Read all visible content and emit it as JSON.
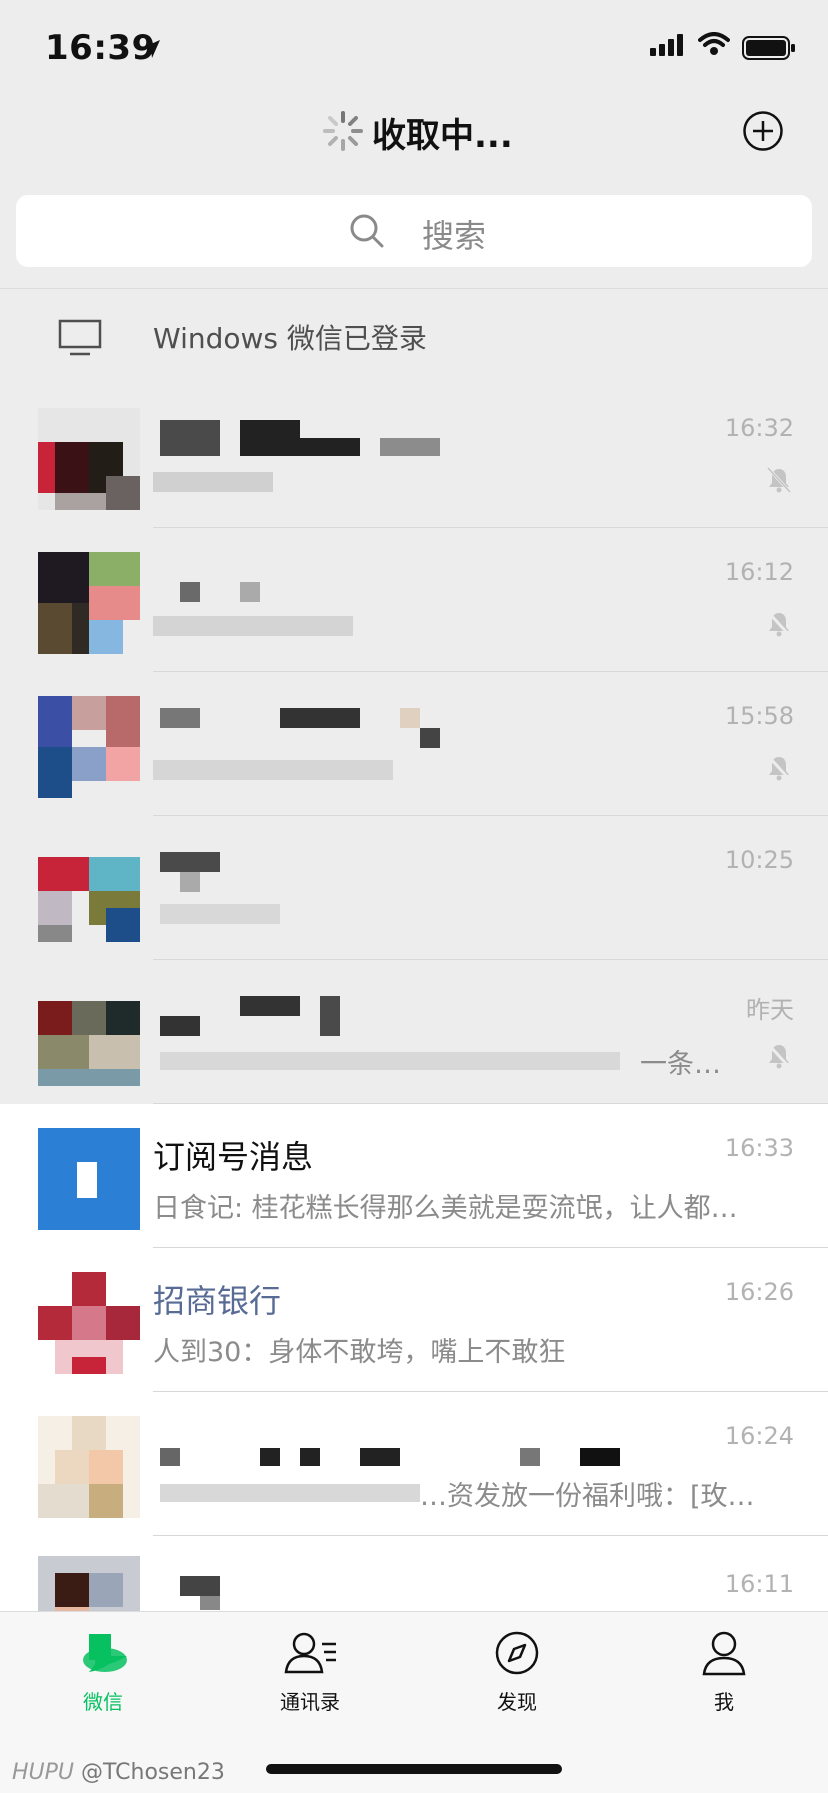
{
  "status_bar": {
    "time": "16:39"
  },
  "nav": {
    "title": "收取中..."
  },
  "search": {
    "placeholder": "搜索"
  },
  "device_banner": {
    "text": "Windows 微信已登录"
  },
  "chats": [
    {
      "time": "16:32",
      "name": "",
      "preview": "",
      "muted": true
    },
    {
      "time": "16:12",
      "name": "",
      "preview": "",
      "muted": true
    },
    {
      "time": "15:58",
      "name": "",
      "preview": "",
      "muted": true
    },
    {
      "time": "10:25",
      "name": "",
      "preview": "",
      "muted": false
    },
    {
      "time": "昨天",
      "name": "",
      "preview": "一条…",
      "muted": true
    },
    {
      "time": "16:33",
      "name": "订阅号消息",
      "preview": "日食记: 桂花糕长得那么美就是耍流氓，让人都…",
      "muted": false
    },
    {
      "time": "16:26",
      "name": "招商银行",
      "preview": "人到30：身体不敢垮，嘴上不敢狂",
      "muted": false
    },
    {
      "time": "16:24",
      "name": "",
      "preview": "…资发放一份福利哦：[玫…",
      "muted": false
    },
    {
      "time": "16:11",
      "name": "",
      "preview": "",
      "muted": false
    }
  ],
  "tabbar": {
    "tabs": [
      {
        "label": "微信",
        "icon": "chat-bubble-icon",
        "active": true
      },
      {
        "label": "通讯录",
        "icon": "contacts-icon",
        "active": false
      },
      {
        "label": "发现",
        "icon": "compass-icon",
        "active": false
      },
      {
        "label": "我",
        "icon": "person-icon",
        "active": false
      }
    ]
  },
  "watermark": {
    "brand": "HUPU",
    "handle": "@TChosen23"
  },
  "colors": {
    "accent": "#07c160",
    "link": "#576b95",
    "background": "#ededed"
  }
}
